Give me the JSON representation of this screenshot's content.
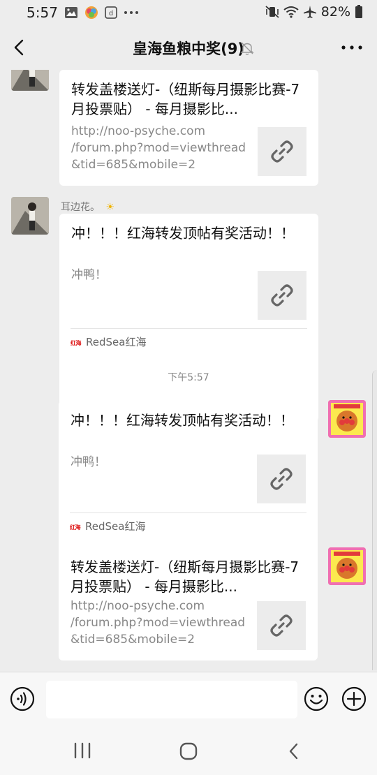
{
  "status": {
    "time": "5:57",
    "battery": "82%"
  },
  "header": {
    "title": "皇海鱼粮中奖(9)"
  },
  "chat": {
    "timestamp": "下午5:57",
    "messages": [
      {
        "title": "转发盖楼送灯-（纽斯每月摄影比赛-7月投票贴） - 每月摄影比...",
        "desc": [
          "http://noo-psyche.com",
          "/forum.php?mod=viewthread",
          "&tid=685&mobile=2"
        ]
      },
      {
        "sender": "耳边花。",
        "sender_emoji": "☀",
        "title": "冲！！！红海转发顶帖有奖活动！！",
        "desc": [
          "冲鸭！"
        ],
        "source": "RedSea红海",
        "source_logo": "红海"
      },
      {
        "title": "冲！！！红海转发顶帖有奖活动！！",
        "desc": [
          "冲鸭！"
        ],
        "source": "RedSea红海",
        "source_logo": "红海"
      },
      {
        "title": "转发盖楼送灯-（纽斯每月摄影比赛-7月投票贴） - 每月摄影比...",
        "desc": [
          "http://noo-psyche.com",
          "/forum.php?mod=viewthread",
          "&tid=685&mobile=2"
        ]
      }
    ]
  },
  "icons": {
    "back": "chevron-left-icon",
    "mute": "bell-off-icon",
    "more": "more-dots-icon",
    "link": "link-icon",
    "voice": "voice-icon",
    "emoji": "emoji-icon",
    "plus": "plus-icon"
  }
}
